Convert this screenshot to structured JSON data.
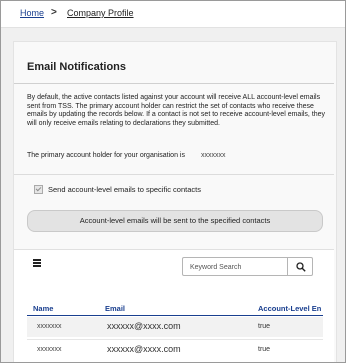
{
  "breadcrumb": {
    "home": "Home",
    "separator": ">",
    "current": "Company Profile"
  },
  "section": {
    "title": "Email Notifications",
    "description": "By default, the active contacts listed against your account will receive ALL account-level emails sent from TSS. The primary account holder can restrict the set of contacts who receive these emails by updating the records below. If a contact is not set to receive account-level emails, they will only receive emails relating to declarations they submitted.",
    "holder_label": "The primary account holder for your organisation is",
    "holder_value": "xxxxxxx"
  },
  "checkbox": {
    "label": "Send account-level emails to specific contacts",
    "checked": true
  },
  "status_message": "Account-level emails will be sent to the specified contacts",
  "search": {
    "placeholder": "Keyword Search"
  },
  "table": {
    "columns": [
      "Name",
      "Email",
      "Account-Level En"
    ],
    "rows": [
      {
        "name": "xxxxxxx",
        "email": "xxxxxx@xxxx.com",
        "account_level": "true"
      },
      {
        "name": "xxxxxxx",
        "email": "xxxxxx@xxxx.com",
        "account_level": "true"
      }
    ]
  },
  "colors": {
    "link": "#1a3f8f",
    "background": "#f0f0f0",
    "status_bar": "#e3e3e3"
  },
  "icons": [
    "menu-icon",
    "search-icon",
    "checkmark-icon"
  ]
}
